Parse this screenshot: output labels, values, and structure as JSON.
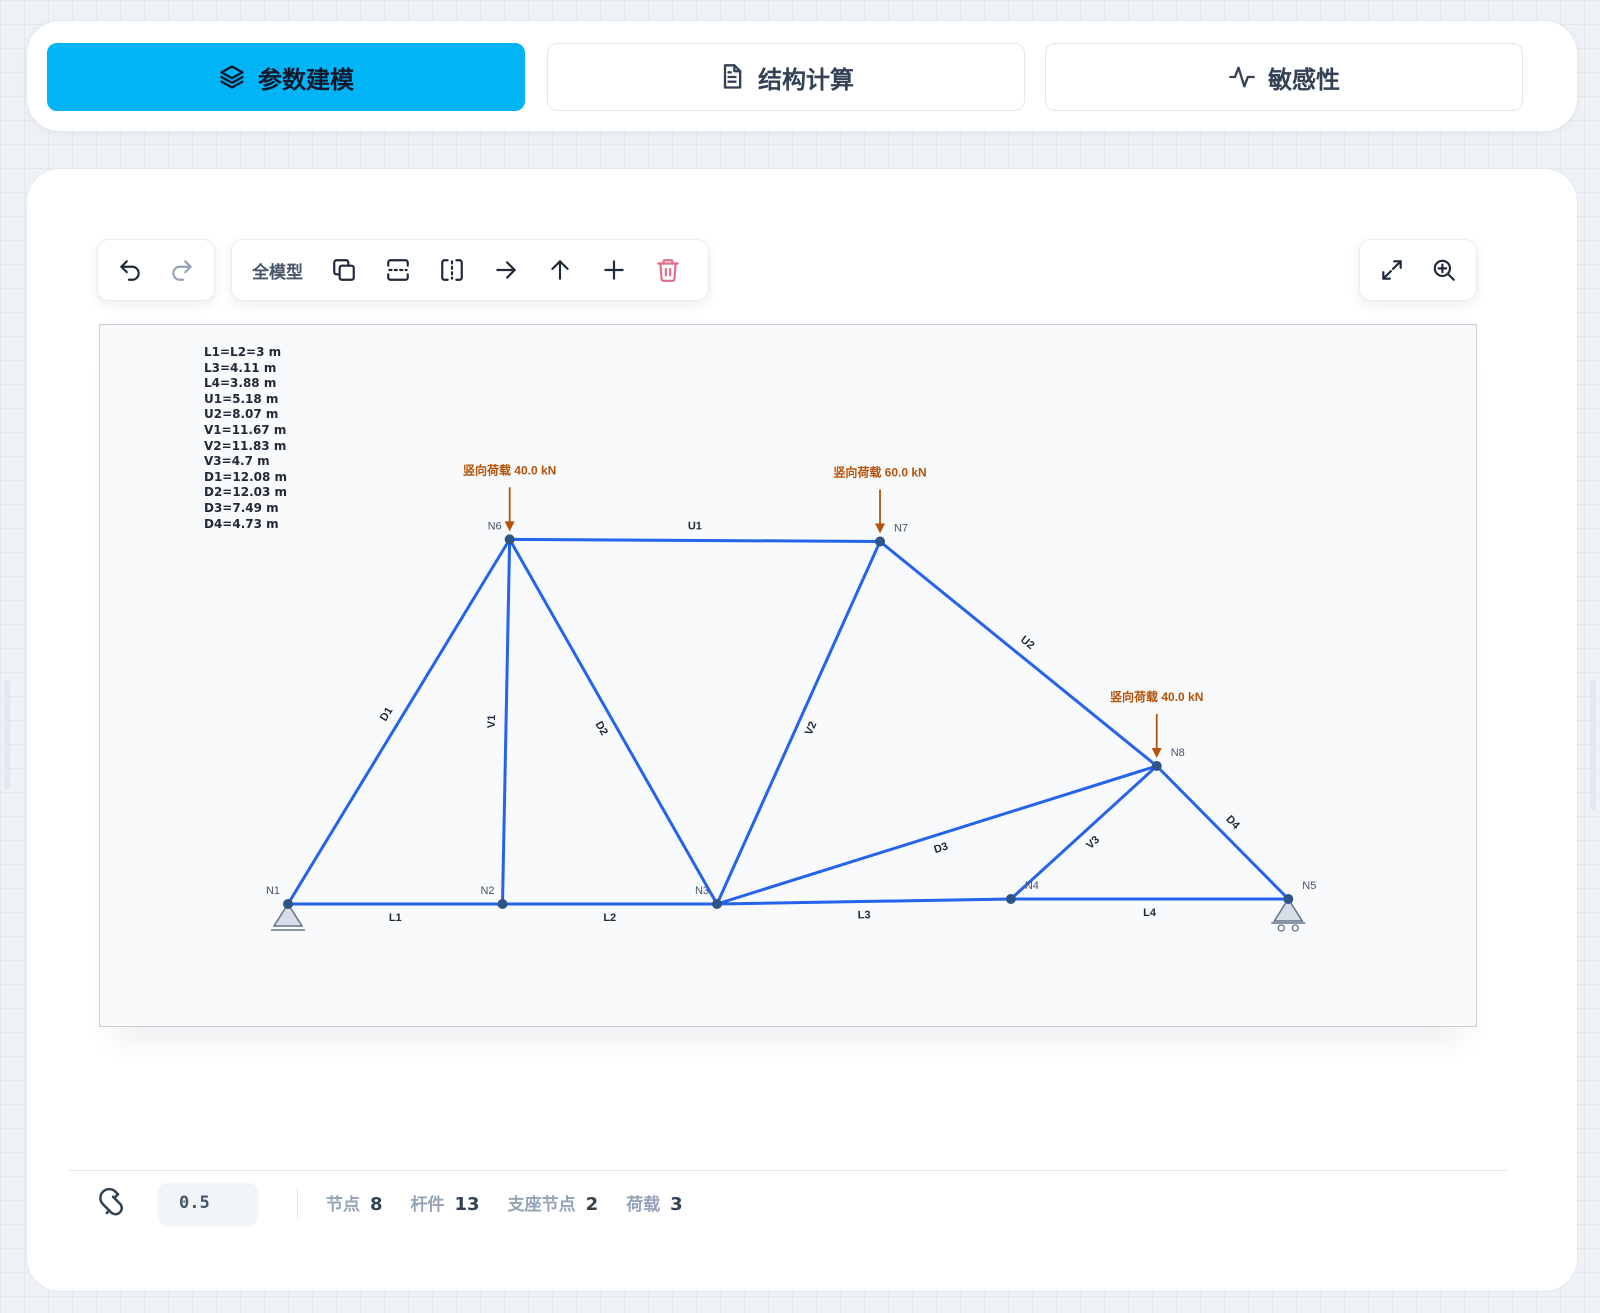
{
  "tabs": [
    {
      "label": "参数建模",
      "icon": "layers-icon",
      "active": true
    },
    {
      "label": "结构计算",
      "icon": "document-icon",
      "active": false
    },
    {
      "label": "敏感性",
      "icon": "activity-icon",
      "active": false
    }
  ],
  "toolbar": {
    "history": [
      {
        "icon": "undo-icon"
      },
      {
        "icon": "redo-icon"
      }
    ],
    "all_model_label": "全模型",
    "tools": [
      {
        "icon": "copy-icon"
      },
      {
        "icon": "split-horizontal-icon"
      },
      {
        "icon": "split-vertical-icon"
      },
      {
        "icon": "arrow-right-icon"
      },
      {
        "icon": "arrow-up-icon"
      },
      {
        "icon": "plus-icon"
      },
      {
        "icon": "trash-icon"
      }
    ],
    "view": [
      {
        "icon": "fullscreen-icon"
      },
      {
        "icon": "zoom-in-icon"
      }
    ]
  },
  "model": {
    "lengths": [
      "L1=L2=3 m",
      "L3=4.11 m",
      "L4=3.88 m",
      "U1=5.18 m",
      "U2=8.07 m",
      "V1=11.67 m",
      "V2=11.83 m",
      "V3=4.7 m",
      "D1=12.08 m",
      "D2=12.03 m",
      "D3=7.49 m",
      "D4=4.73 m"
    ],
    "nodes": [
      {
        "id": "N1",
        "x": 0,
        "y": 0,
        "support": "pin"
      },
      {
        "id": "N2",
        "x": 3,
        "y": 0
      },
      {
        "id": "N3",
        "x": 6,
        "y": 0
      },
      {
        "id": "N4",
        "x": 10.11,
        "y": 0.07
      },
      {
        "id": "N5",
        "x": 13.99,
        "y": 0.07,
        "support": "roller"
      },
      {
        "id": "N6",
        "x": 3.1,
        "y": 5.1
      },
      {
        "id": "N7",
        "x": 8.28,
        "y": 5.07
      },
      {
        "id": "N8",
        "x": 12.15,
        "y": 1.93
      }
    ],
    "members": [
      {
        "label": "L1",
        "from": "N1",
        "to": "N2"
      },
      {
        "label": "L2",
        "from": "N2",
        "to": "N3"
      },
      {
        "label": "L3",
        "from": "N3",
        "to": "N4"
      },
      {
        "label": "L4",
        "from": "N4",
        "to": "N5"
      },
      {
        "label": "U1",
        "from": "N6",
        "to": "N7"
      },
      {
        "label": "U2",
        "from": "N7",
        "to": "N8"
      },
      {
        "label": "V1",
        "from": "N2",
        "to": "N6"
      },
      {
        "label": "V2",
        "from": "N3",
        "to": "N7"
      },
      {
        "label": "V3",
        "from": "N4",
        "to": "N8"
      },
      {
        "label": "D1",
        "from": "N1",
        "to": "N6"
      },
      {
        "label": "D2",
        "from": "N6",
        "to": "N3"
      },
      {
        "label": "D3",
        "from": "N3",
        "to": "N8"
      },
      {
        "label": "D4",
        "from": "N8",
        "to": "N5"
      }
    ],
    "loads": [
      {
        "node": "N6",
        "label": "竖向荷载 40.0 kN"
      },
      {
        "node": "N7",
        "label": "竖向荷载 60.0 kN"
      },
      {
        "node": "N8",
        "label": "竖向荷载 40.0 kN"
      }
    ],
    "colors": {
      "member": "#2563eb",
      "node": "#2f5488",
      "load": "#b45309",
      "support": "#64748b"
    }
  },
  "footer": {
    "snap_value": "0.5",
    "stats": [
      {
        "label": "节点",
        "value": "8"
      },
      {
        "label": "杆件",
        "value": "13"
      },
      {
        "label": "支座节点",
        "value": "2"
      },
      {
        "label": "荷载",
        "value": "3"
      }
    ]
  }
}
